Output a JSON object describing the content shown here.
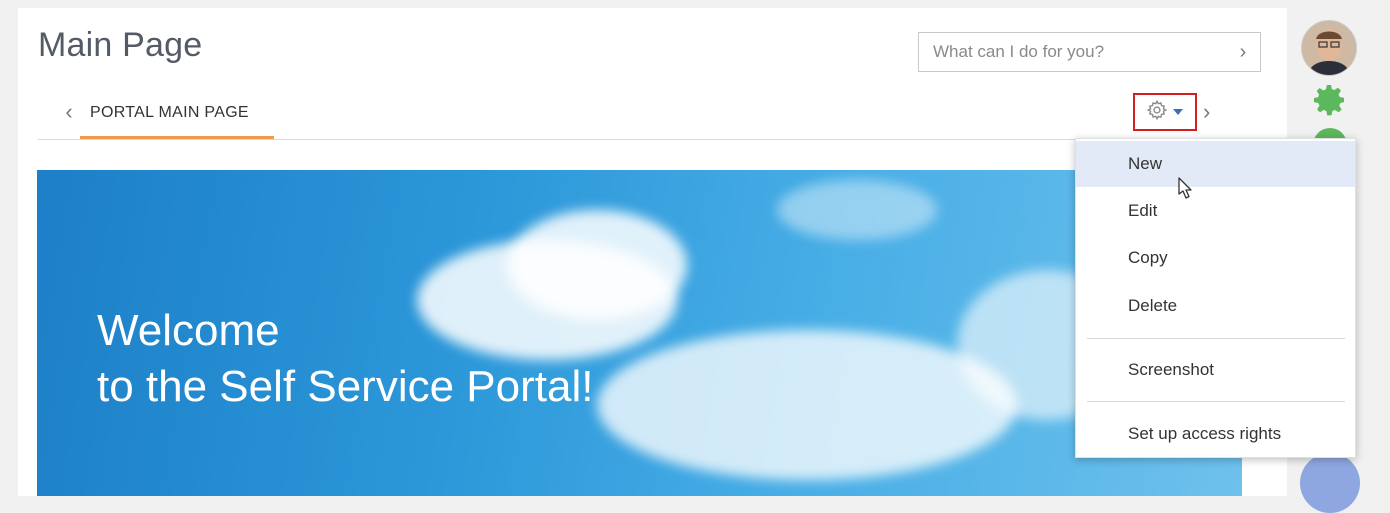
{
  "header": {
    "title": "Main Page",
    "search_placeholder": "What can I do for you?",
    "search_go": "›"
  },
  "tabs": {
    "prev": "‹",
    "next": "›",
    "items": [
      {
        "label": "PORTAL MAIN PAGE",
        "active": true
      }
    ],
    "settings_icon": "gear-icon",
    "dropdown_icon": "caret-down-icon"
  },
  "banner": {
    "line1": "Welcome",
    "line2": "to the Self Service Portal!"
  },
  "menu": {
    "items": [
      {
        "label": "New",
        "highlighted": true
      },
      {
        "label": "Edit"
      },
      {
        "label": "Copy"
      },
      {
        "label": "Delete"
      },
      {
        "label": "Screenshot"
      },
      {
        "label": "Set up access rights"
      }
    ]
  },
  "right_rail": {
    "icons": [
      "avatar",
      "gear-icon",
      "help-icon",
      "phone-icon"
    ]
  },
  "colors": {
    "accent_tab": "#f19a49",
    "highlight_box": "#d31f1f",
    "menu_hover": "#e3eaf7",
    "rail_gear": "#5cb85c",
    "phone_button": "#8fa7e0"
  }
}
